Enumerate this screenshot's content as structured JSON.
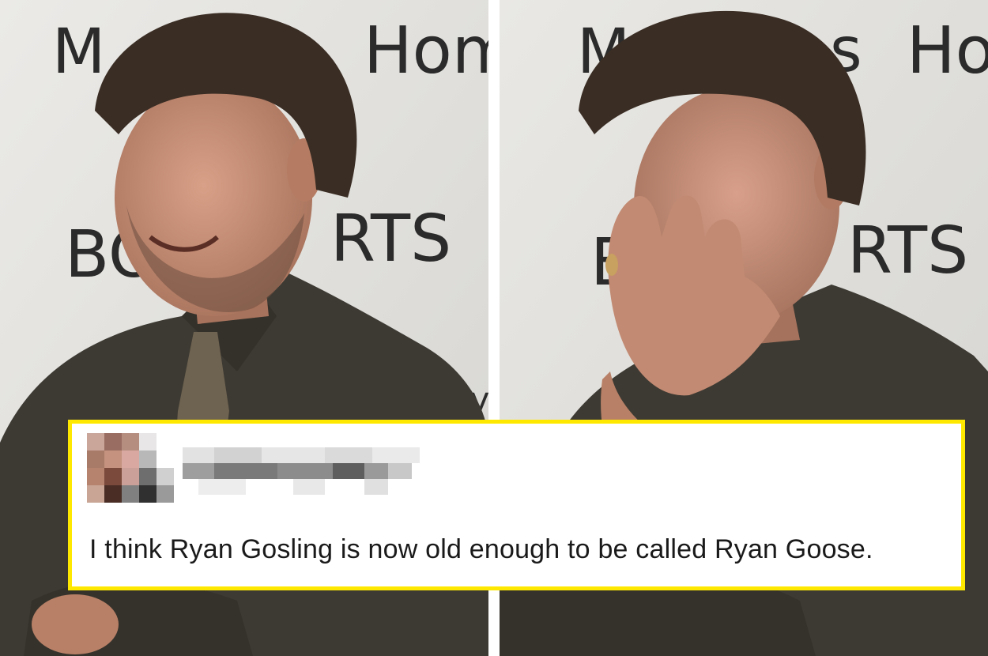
{
  "left_panel": {
    "board_lines": [
      "M",
      "Hom",
      "BOO",
      "RTS",
      "hy"
    ]
  },
  "right_panel": {
    "board_lines": [
      "M",
      "s",
      "Ho",
      "B",
      "RTS"
    ]
  },
  "tweet": {
    "text": "I think Ryan Gosling is now old enough to be called Ryan Goose.",
    "border_color": "#ffe800",
    "username_pixelated": true,
    "avatar_pixelated": true
  },
  "colors": {
    "whiteboard": "#e4e3e0",
    "shirt": "#3d3a33",
    "hair": "#3a2d24",
    "skin": "#c08a70"
  }
}
